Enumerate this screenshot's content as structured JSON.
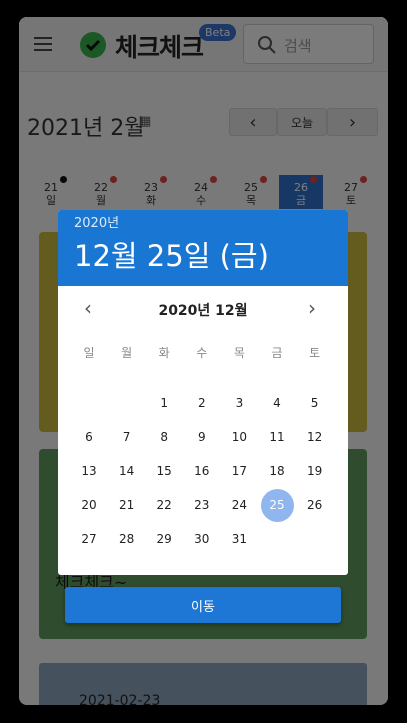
{
  "header": {
    "logo_text": "체크체크",
    "beta": "Beta",
    "search_placeholder": "검색"
  },
  "calendar": {
    "month_title": "2021년 2월",
    "prev": "‹",
    "today": "오늘",
    "next": "›"
  },
  "days": [
    {
      "num": "21",
      "wd": "일",
      "dot": "black"
    },
    {
      "num": "22",
      "wd": "월",
      "dot": "red"
    },
    {
      "num": "23",
      "wd": "화",
      "dot": "red"
    },
    {
      "num": "24",
      "wd": "수",
      "dot": "red"
    },
    {
      "num": "25",
      "wd": "목",
      "dot": "red"
    },
    {
      "num": "26",
      "wd": "금",
      "dot": "red",
      "selected": true
    },
    {
      "num": "27",
      "wd": "토",
      "dot": "red"
    }
  ],
  "cards": {
    "text1": "체크체크~",
    "bottom_date": "2021-02-23"
  },
  "dialog": {
    "year": "2020년",
    "date": "12월 25일 (금)",
    "month_label": "2020년 12월",
    "weekdays": [
      "일",
      "월",
      "화",
      "수",
      "목",
      "금",
      "토"
    ],
    "first_weekday": 2,
    "days_in_month": 31,
    "selected_day": 25,
    "go_button": "이동"
  }
}
